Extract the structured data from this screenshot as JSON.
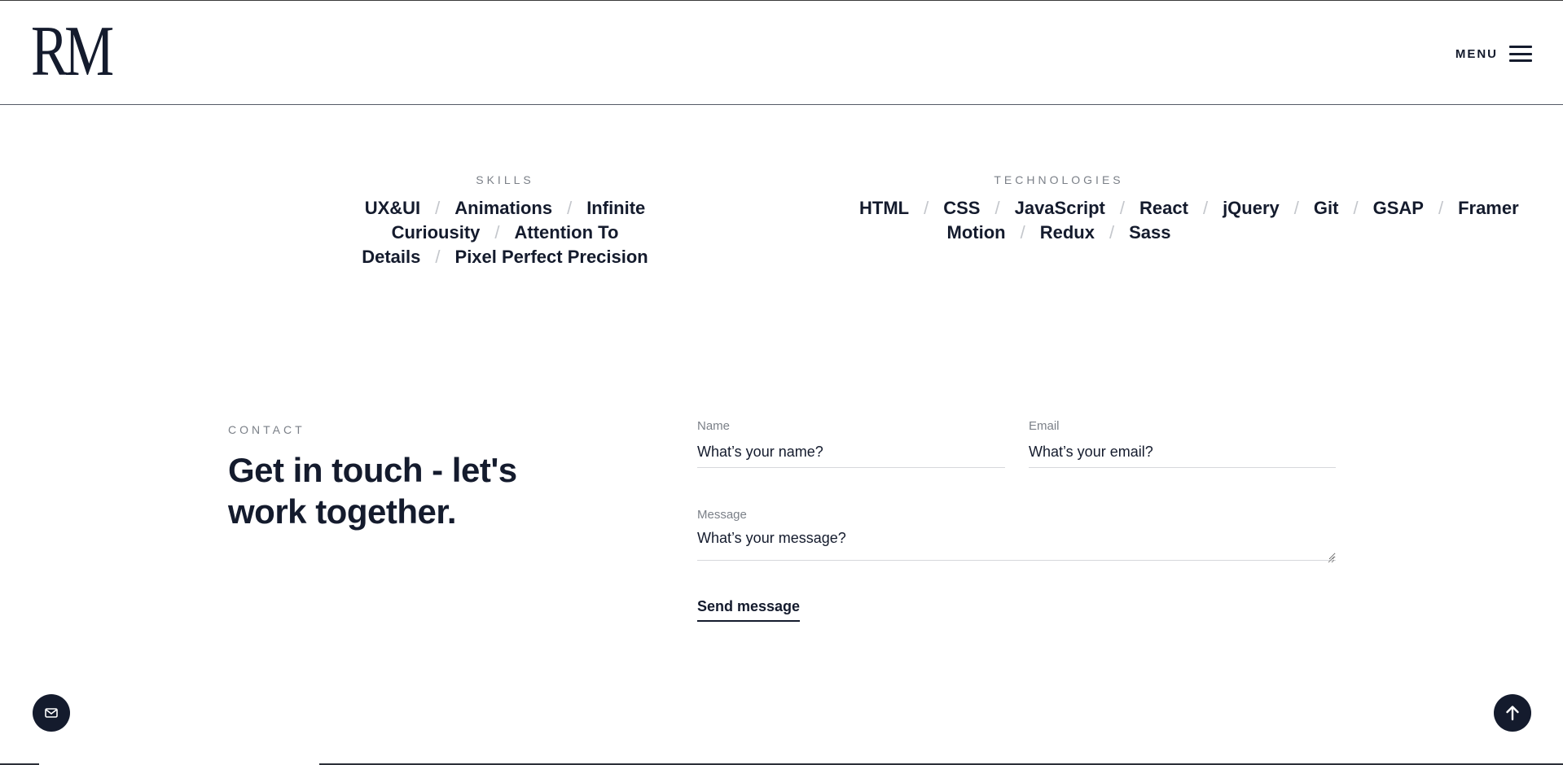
{
  "header": {
    "logo_text": "RM",
    "menu_label": "MENU"
  },
  "skills": {
    "title": "SKILLS",
    "items": [
      "UX&UI",
      "Animations",
      "Infinite Curiousity",
      "Attention To Details",
      "Pixel Perfect Precision"
    ]
  },
  "technologies": {
    "title": "TECHNOLOGIES",
    "items": [
      "HTML",
      "CSS",
      "JavaScript",
      "React",
      "jQuery",
      "Git",
      "GSAP",
      "Framer Motion",
      "Redux",
      "Sass"
    ]
  },
  "contact": {
    "label": "CONTACT",
    "heading_line1": "Get in touch - let's",
    "heading_line2": "work together.",
    "form": {
      "name_label": "Name",
      "name_placeholder": "What’s your name?",
      "email_label": "Email",
      "email_placeholder": "What’s your email?",
      "message_label": "Message",
      "message_placeholder": "What’s your message?",
      "submit_label": "Send message"
    }
  },
  "icons": {
    "mail_button": "mail-icon",
    "scroll_top_button": "arrow-up-icon",
    "menu": "hamburger-icon"
  },
  "colors": {
    "primary": "#141b2d",
    "muted": "#7b8088",
    "separator": "#c4c7cc"
  },
  "scroll_progress": 0.18
}
